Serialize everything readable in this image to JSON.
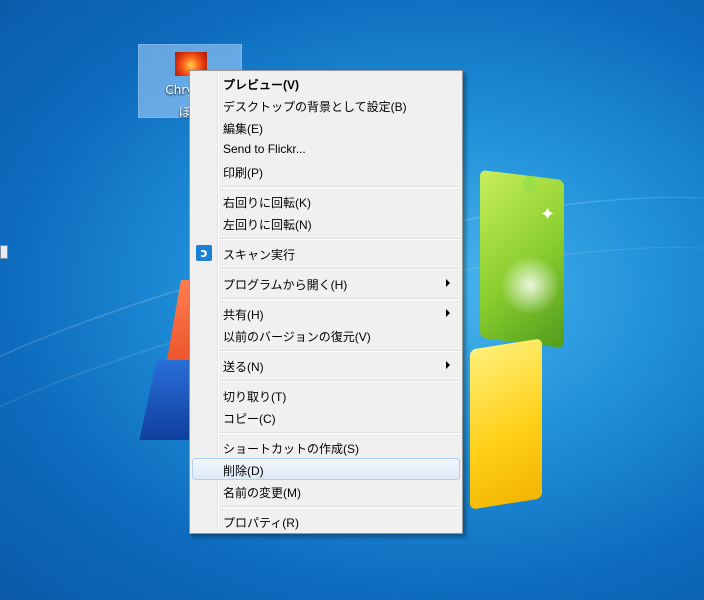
{
  "desktop": {
    "icon_label_line1": "Chrysan",
    "icon_label_line2": "ぼ"
  },
  "context_menu": {
    "items": [
      {
        "label": "プレビュー(V)"
      },
      {
        "label": "デスクトップの背景として設定(B)"
      },
      {
        "label": "編集(E)"
      },
      {
        "label": "Send to Flickr..."
      },
      {
        "label": "印刷(P)"
      },
      {
        "label": "右回りに回転(K)"
      },
      {
        "label": "左回りに回転(N)"
      },
      {
        "label": "スキャン実行",
        "icon": "scan-icon"
      },
      {
        "label": "プログラムから開く(H)"
      },
      {
        "label": "共有(H)"
      },
      {
        "label": "以前のバージョンの復元(V)"
      },
      {
        "label": "送る(N)"
      },
      {
        "label": "切り取り(T)"
      },
      {
        "label": "コピー(C)"
      },
      {
        "label": "ショートカットの作成(S)"
      },
      {
        "label": "削除(D)"
      },
      {
        "label": "名前の変更(M)"
      },
      {
        "label": "プロパティ(R)"
      }
    ],
    "highlighted_item": "削除(D)"
  },
  "colors": {
    "desktop_bg": "#1f8fd8",
    "menu_bg": "#f0f0f0",
    "menu_border": "#979797",
    "hover_border": "#aecff7"
  }
}
